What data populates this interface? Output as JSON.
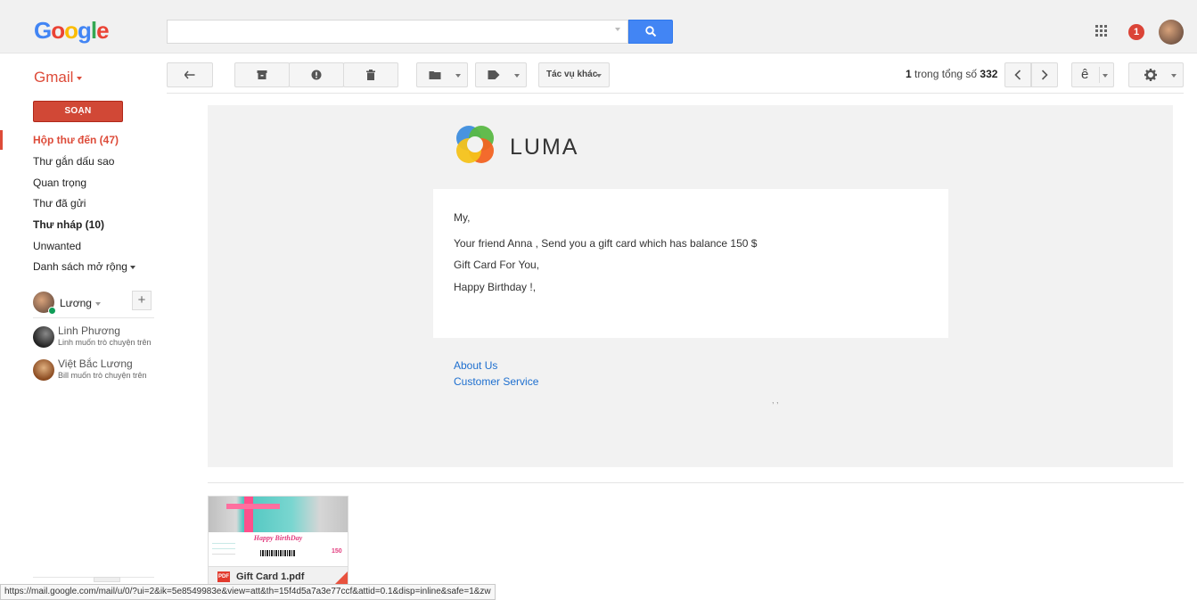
{
  "header": {
    "logo": {
      "g1": "G",
      "o1": "o",
      "o2": "o",
      "g2": "g",
      "l": "l",
      "e": "e"
    },
    "search": {
      "value": "",
      "placeholder": ""
    },
    "notification_count": "1"
  },
  "toolbar": {
    "app_label": "Gmail",
    "more_actions_label": "Tác vụ khác",
    "pager": {
      "current": "1",
      "middle": " trong tổng số ",
      "total": "332"
    },
    "language_label": "ê"
  },
  "sidebar": {
    "compose_label": "SOẠN",
    "items": [
      {
        "label": "Hộp thư đến (47)"
      },
      {
        "label": "Thư gắn dấu sao"
      },
      {
        "label": "Quan trọng"
      },
      {
        "label": "Thư đã gửi"
      },
      {
        "label": "Thư nháp (10)"
      },
      {
        "label": "Unwanted"
      },
      {
        "label": "Danh sách mở rộng"
      }
    ],
    "hangouts_user": "Lương",
    "hangouts_add": "+",
    "contacts": [
      {
        "name": "Linh Phương",
        "message": "Linh muốn trò chuyện trên"
      },
      {
        "name": "Việt Bắc Lương",
        "message": "Bill muốn trò chuyện trên"
      }
    ]
  },
  "email": {
    "brand": "LUMA",
    "lines": [
      "My,",
      "Your friend Anna , Send you a gift card which has balance 150 $",
      "Gift Card For You,",
      "Happy Birthday !,"
    ],
    "links": [
      "About Us",
      "Customer Service"
    ],
    "footer_dots": ", ,",
    "attachment": {
      "file_name": "Gift Card 1.pdf",
      "file_type": "PDF",
      "preview_title": "Happy BirthDay",
      "preview_value": "150"
    }
  },
  "statusbar": {
    "url": "https://mail.google.com/mail/u/0/?ui=2&ik=5e8549983e&view=att&th=15f4d5a7a3e77ccf&attid=0.1&disp=inline&safe=1&zw"
  },
  "colors": {
    "brand_red": "#dd4b39",
    "compose_red": "#d14836",
    "search_blue": "#4285f4",
    "link_blue": "#1e6fcf",
    "online_green": "#0f9d58"
  },
  "icons": {
    "search": "search-icon",
    "apps": "apps-grid-icon",
    "back": "back-arrow-icon",
    "archive": "archive-icon",
    "spam": "report-spam-icon",
    "delete": "trash-icon",
    "move": "folder-icon",
    "labels": "label-tag-icon",
    "settings": "gear-icon"
  }
}
